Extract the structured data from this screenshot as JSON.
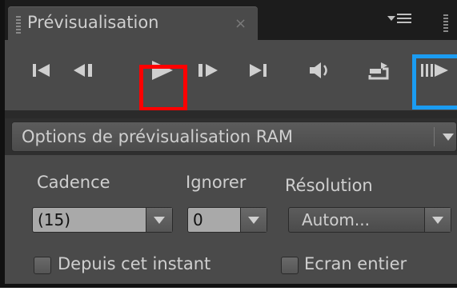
{
  "panel": {
    "tab_title": "Prévisualisation",
    "close_glyph": "×"
  },
  "controls": [
    {
      "name": "first-frame-icon"
    },
    {
      "name": "previous-frame-icon"
    },
    {
      "name": "play-icon"
    },
    {
      "name": "next-frame-icon"
    },
    {
      "name": "last-frame-icon"
    },
    {
      "name": "audio-icon"
    },
    {
      "name": "loop-icon"
    },
    {
      "name": "ram-preview-icon"
    }
  ],
  "ram_options": {
    "label": "Options de prévisualisation RAM"
  },
  "settings": {
    "cadence_label": "Cadence",
    "cadence_value": "(15)",
    "ignorer_label": "Ignorer",
    "ignorer_value": "0",
    "resolution_label": "Résolution",
    "resolution_value": "Autom...",
    "from_current_label": "Depuis cet instant",
    "fullscreen_label": "Ecran entier"
  },
  "colors": {
    "highlight_play": "#ff0000",
    "highlight_ram": "#1b9cf2"
  }
}
